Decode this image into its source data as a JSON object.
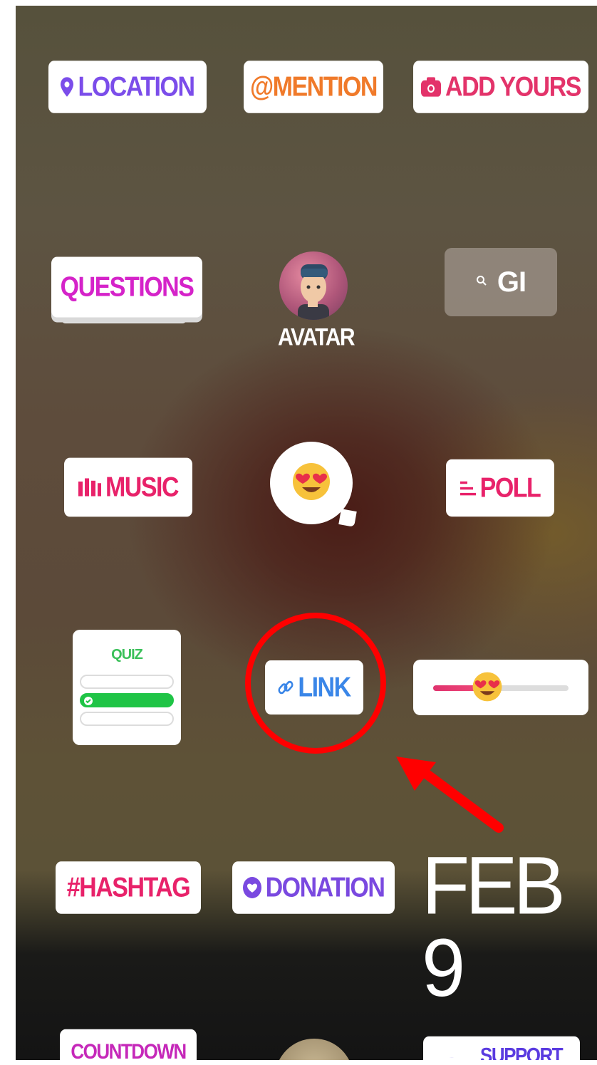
{
  "colors": {
    "location": "#7b4dea",
    "mention": "#f07a2a",
    "add_yours": "#e3336a",
    "questions": "#d523c9",
    "music": "#e8226a",
    "poll": "#e8226a",
    "quiz": "#3bc05a",
    "link": "#3a86e8",
    "hashtag": "#e8226a",
    "donation": "#7a49e0",
    "countdown": "#c528b9",
    "support": "#5a3be0",
    "annotation": "#ff0000"
  },
  "stickers": {
    "location": {
      "label": "LOCATION",
      "icon": "map-pin-icon"
    },
    "mention": {
      "label": "@MENTION"
    },
    "add_yours": {
      "label": "ADD YOURS",
      "icon": "camera-icon"
    },
    "questions": {
      "label": "QUESTIONS"
    },
    "avatar": {
      "label": "AVATAR"
    },
    "gif_search": {
      "label": "GI",
      "icon": "search-icon"
    },
    "music": {
      "label": "MUSIC",
      "icon": "audio-bars-icon"
    },
    "emoji_reaction": {
      "icon": "heart-eyes-emoji-icon"
    },
    "poll": {
      "label": "POLL",
      "icon": "poll-lines-icon"
    },
    "quiz": {
      "label": "QUIZ"
    },
    "link": {
      "label": "LINK",
      "icon": "link-icon"
    },
    "emoji_slider": {
      "icon": "heart-eyes-emoji-icon",
      "level": 0.4
    },
    "hashtag": {
      "label": "#HASHTAG"
    },
    "donation": {
      "label": "DONATION",
      "icon": "heart-badge-icon"
    },
    "date": {
      "label": "FEB 9"
    },
    "countdown": {
      "label": "COUNTDOWN"
    },
    "support": {
      "label": "SUPPORT"
    }
  }
}
